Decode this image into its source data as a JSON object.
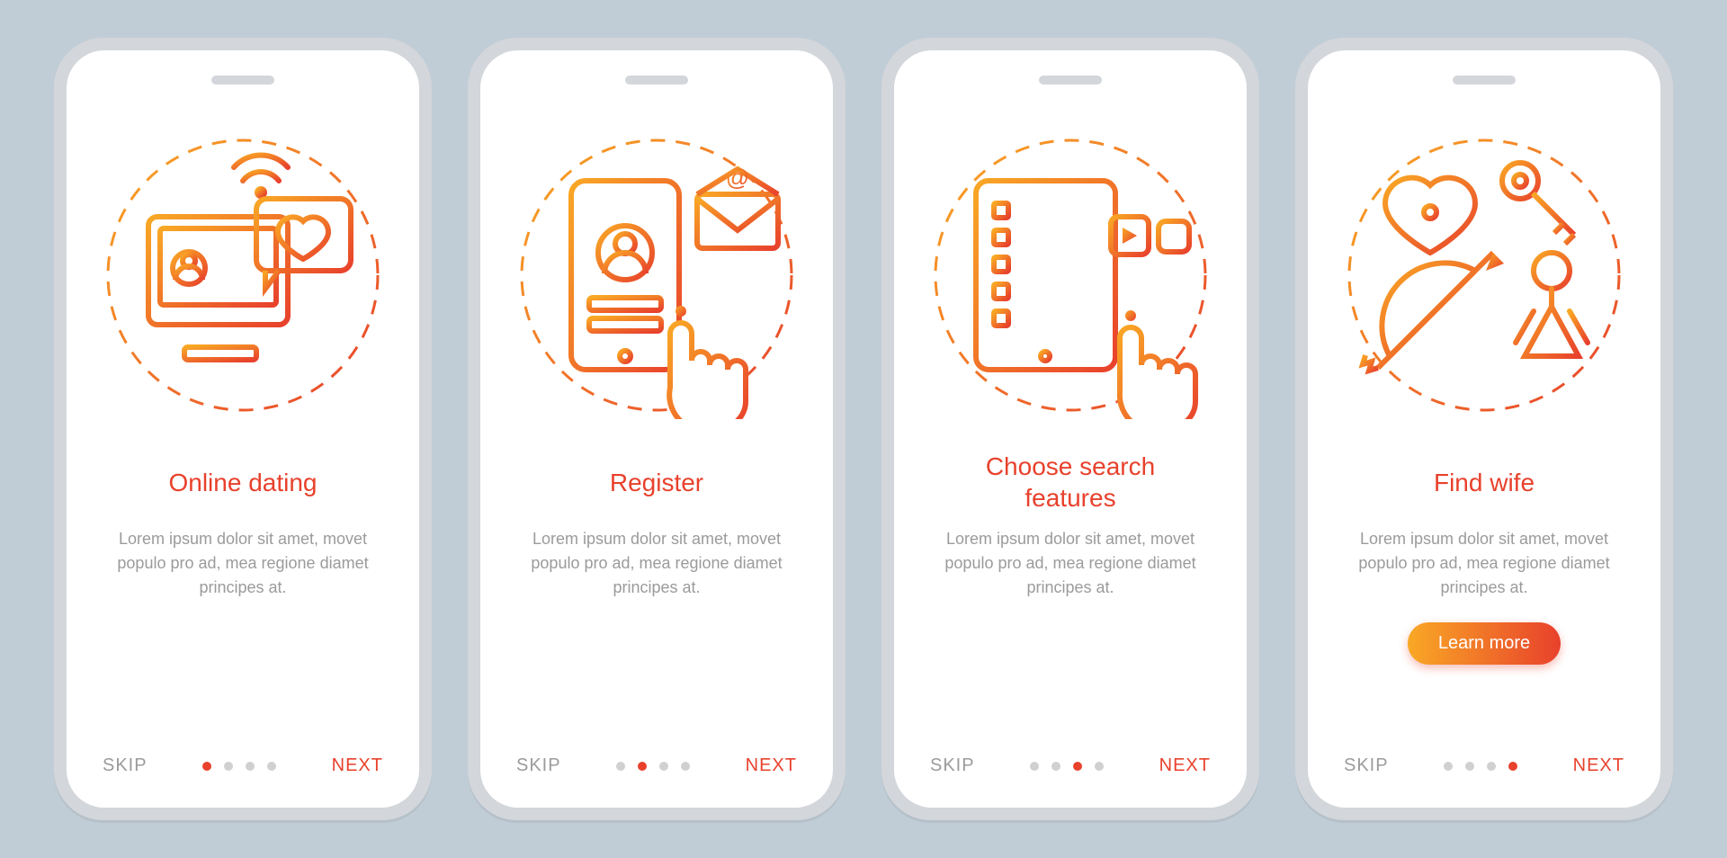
{
  "common": {
    "body": "Lorem ipsum dolor sit amet, movet populo pro ad, mea regione diamet principes at.",
    "skip": "SKIP",
    "next": "NEXT",
    "cta": "Learn more",
    "total_slides": 4,
    "colors": {
      "accent": "#e8412c",
      "gradient_start": "#f9a825",
      "gradient_end": "#e8412c",
      "muted": "#9b9b9b"
    }
  },
  "slides": [
    {
      "title": "Online dating",
      "active_dot": 0,
      "icon": "online-dating-icon",
      "show_cta": false
    },
    {
      "title": "Register",
      "active_dot": 1,
      "icon": "register-icon",
      "show_cta": false
    },
    {
      "title": "Choose search features",
      "active_dot": 2,
      "icon": "search-features-icon",
      "show_cta": false
    },
    {
      "title": "Find wife",
      "active_dot": 3,
      "icon": "find-wife-icon",
      "show_cta": true
    }
  ]
}
